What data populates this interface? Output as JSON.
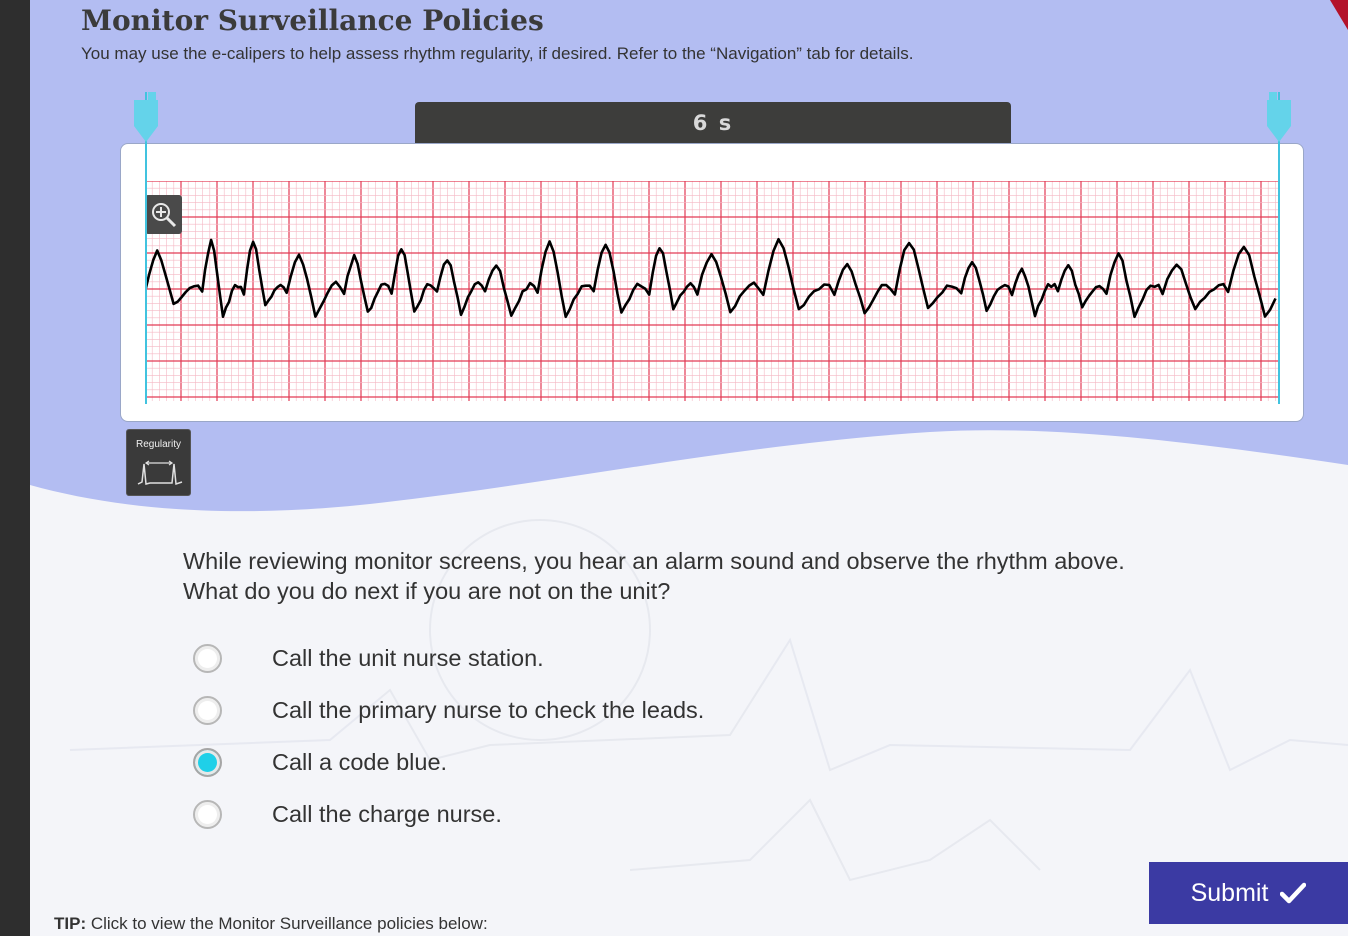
{
  "header": {
    "title": "Monitor Surveillance Policies",
    "subtitle": "You may use the e-calipers to help assess rhythm regularity, if desired. Refer to the “Navigation” tab for details."
  },
  "strip": {
    "duration_label": "6 s",
    "tool_label": "Regularity"
  },
  "question": {
    "line1": "While reviewing monitor screens, you hear an alarm sound and observe the rhythm above.",
    "line2": "What do you do next if you are not on the unit?"
  },
  "options": [
    {
      "label": "Call the unit nurse station.",
      "selected": false
    },
    {
      "label": "Call the primary nurse to check the leads.",
      "selected": false
    },
    {
      "label": "Call a code blue.",
      "selected": true
    },
    {
      "label": "Call the charge nurse.",
      "selected": false
    }
  ],
  "submit": {
    "label": "Submit"
  },
  "tip": {
    "prefix": "TIP:",
    "text": " Click to view the Monitor Surveillance policies below:"
  },
  "colors": {
    "header_bg": "#b3bdf2",
    "grid_major": "#e23a55",
    "grid_minor": "#f5b8c4",
    "caliper": "#41c3df",
    "selected_radio": "#1fd0e8",
    "submit_bg": "#3b3aa3"
  }
}
